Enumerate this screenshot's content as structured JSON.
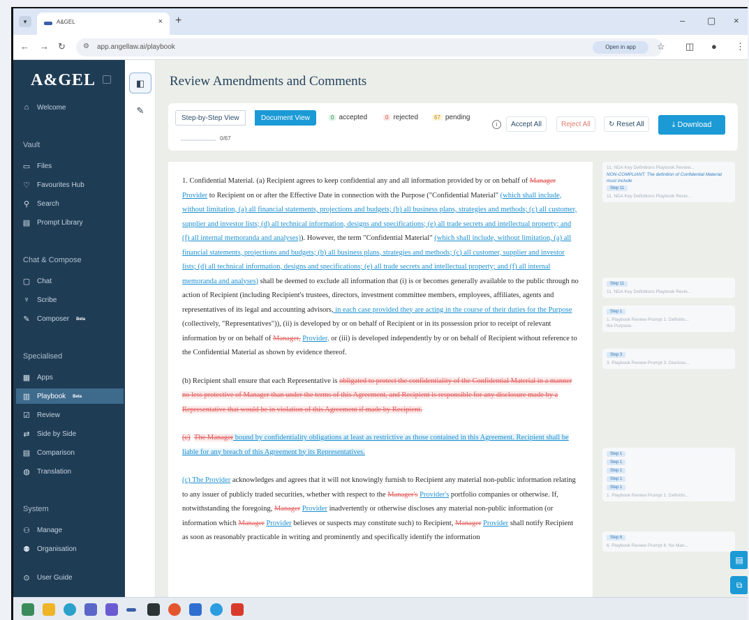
{
  "browser": {
    "tab_title": "A&GEL",
    "tab_close": "×",
    "new_tab": "+",
    "minimize": "–",
    "maximize": "▢",
    "close": "×",
    "url": "app.angellaw.ai/playbook",
    "open_in_app": "Open in app"
  },
  "sidebar": {
    "logo": "A&GEL",
    "welcome": "Welcome",
    "sections": {
      "vault": "Vault",
      "chat_compose": "Chat & Compose",
      "specialised": "Specialised",
      "system": "System"
    },
    "vault_items": [
      "Files",
      "Favourites Hub",
      "Search",
      "Prompt Library"
    ],
    "chat_items": [
      "Chat",
      "Scribe",
      "Composer"
    ],
    "specialised_items": [
      "Apps",
      "Playbook",
      "Review",
      "Side by Side",
      "Comparison",
      "Translation"
    ],
    "system_items": [
      "Manage",
      "Organisation"
    ],
    "user_guide": "User Guide",
    "beta": "Beta"
  },
  "main": {
    "title": "Review Amendments and Comments",
    "view_step": "Step-by-Step View",
    "view_document": "Document View",
    "accepted_count": "0",
    "accepted_label": "accepted",
    "rejected_count": "0",
    "rejected_label": "rejected",
    "pending_count": "67",
    "pending_label": "pending",
    "progress_text": "0/67",
    "accept_all": "Accept All",
    "reject_all": "Reject All",
    "reset_all": "Reset All",
    "download": "Download"
  },
  "document": {
    "p1": {
      "a": "1.   Confidential Material.  (a)   Recipient agrees to keep confidential any and all information provided by or on behalf of ",
      "mgr1": "Manager",
      "prov1": "Provider",
      "b": " to Recipient on or after the Effective Date in connection with the Purpose (\"Confidential Material\" ",
      "ins1": "(which shall include, without limitation, (a) all financial statements, projections and budgets; (b) all business plans, strategies and methods; (c) all customer, supplier and investor lists; (d) all technical information, designs and specifications; (e) all trade secrets and intellectual property; and (f) all internal memoranda and analyses)",
      "c": ").  However, the term \"Confidential Material\" ",
      "ins2": "(which shall include, without limitation, (a) all financial statements, projections and budgets; (b) all business plans, strategies and methods; (c) all customer, supplier and investor lists; (d) all technical information, designs and specifications; (e) all trade secrets and intellectual property; and (f) all internal memoranda and analyses)",
      "d": " shall be deemed to exclude all information that (i) is or becomes generally available to the public through no action of Recipient (including Recipient's trustees, directors, investment committee members, employees, affiliates, agents and representatives of its legal and accounting advisors,",
      "ins3": " in each case provided they are acting in the course of their duties for the Purpose",
      "e": " (collectively, \"Representatives\")), (ii) is developed by or on behalf of Recipient or in its possession prior to receipt of relevant information by or on behalf of ",
      "mgr2": "Manager,",
      "prov2": "Provider,",
      "f": " or (iii) is developed independently by or on behalf of Recipient without reference to the Confidential Material as shown by evidence thereof."
    },
    "p2": {
      "a": "(b)  Recipient shall ensure that each Representative is ",
      "del1": "obligated to protect the confidentiality of the Confidential Material in a manner no less protective of Manager than under the terms of this Agreement, and Recipient is responsible for any disclosure made by a Representative that would be in violation of this Agreement if made by Recipient."
    },
    "p3": {
      "del1": "(c)",
      "del2": "The Manager",
      "ins1": " bound by confidentiality obligations at least as restrictive as those contained in this Agreement. Recipient shall be liable for any breach of this Agreement by its Representatives."
    },
    "p4": {
      "ins1": "(c)  The  Provider",
      "a": " acknowledges and agrees that it will not knowingly furnish to Recipient any material non-public information relating to any issuer of publicly traded securities, whether with respect to the ",
      "mgr1": "Manager's",
      "prov1": "Provider's",
      "b": " portfolio companies or otherwise.  If, notwithstanding the foregoing, ",
      "mgr2": "Manager",
      "prov2": "Provider",
      "c": " inadvertently or otherwise discloses any material non-public information (or information which ",
      "mgr3": "Manager",
      "prov3": "Provider",
      "d": " believes or suspects may constitute such) to Recipient, ",
      "mgr4": "Manager",
      "prov4": "Provider",
      "e": " shall notify Recipient as soon as reasonably practicable in writing and prominently and specifically identify the information"
    }
  },
  "comments": {
    "c1_line1": "11. NDA Key Definitions Playbook Review...",
    "c1_nc": "NON-COMPLIANT: The definition of Confidential Material must include",
    "c1_step": "Step 11",
    "c1_line2": "11. NDA Key Definitions Playbook Revie...",
    "c2_step": "Step 11",
    "c2_line": "11. NDA Key Definitions Playbook Revie...",
    "c3_step": "Step 1",
    "c3_line": "1. Playbook Review Prompt 1: Definitio...",
    "c3_line2": "the Purpose.",
    "c4_step": "Step 3",
    "c4_line": "3. Playbook Review Prompt 3: Disclosu...",
    "c5_steps": [
      "Step 1",
      "Step 1",
      "Step 1",
      "Step 1",
      "Step 1"
    ],
    "c5_line": "1. Playbook Review Prompt 1: Definitio...",
    "c6_step": "Step 6",
    "c6_line": "6. Playbook Review Prompt 6: No Man..."
  },
  "colors": {
    "sidebar": "#1f3c55",
    "accent": "#1b9ad6",
    "insertion": "#1b8fd0",
    "deletion": "#e25d5d"
  }
}
